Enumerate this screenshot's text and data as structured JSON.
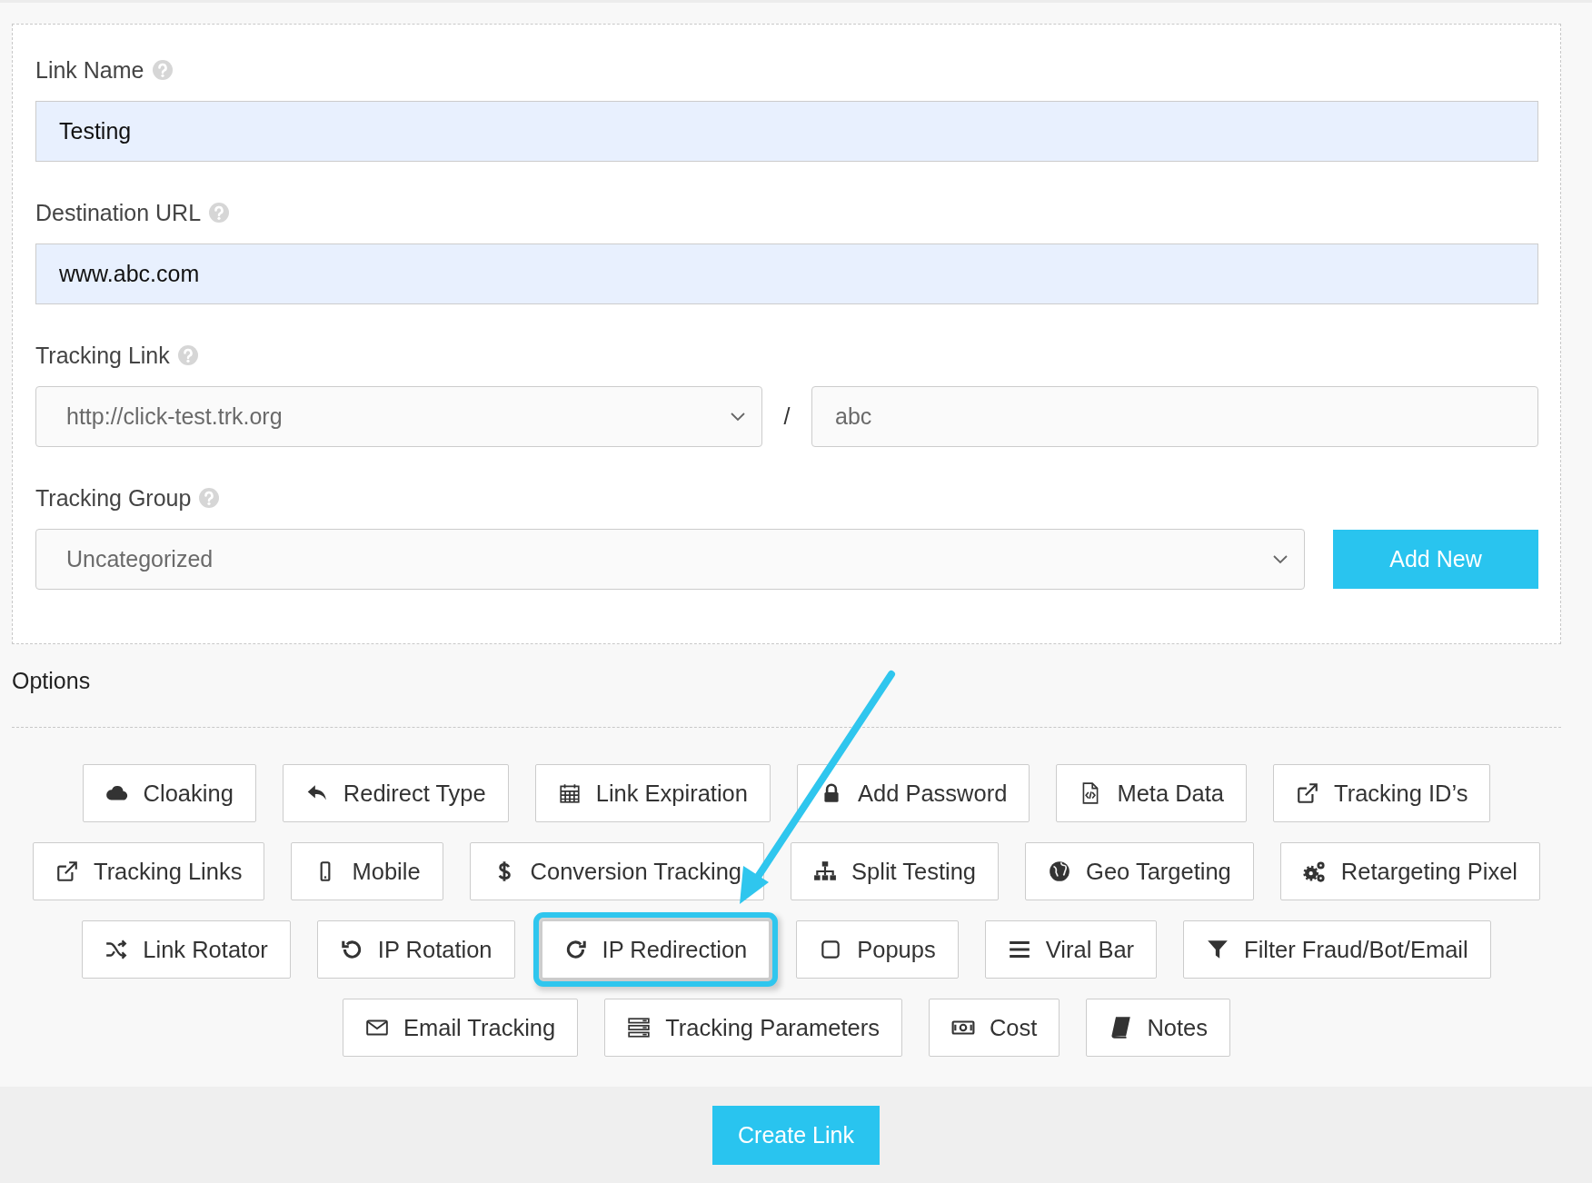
{
  "fields": [
    {
      "label": "Link Name",
      "value": "Testing"
    },
    {
      "label": "Destination URL",
      "value": "www.abc.com"
    }
  ],
  "tracking_link": {
    "label": "Tracking Link",
    "domain": "http://click-test.trk.org",
    "separator": "/",
    "slug": "abc"
  },
  "tracking_group": {
    "label": "Tracking Group",
    "value": "Uncategorized",
    "add_button": "Add New"
  },
  "options": {
    "title": "Options",
    "lines": [
      {
        "buttons": [
          {
            "label": "Cloaking",
            "highlighted": false
          },
          {
            "label": "Redirect Type",
            "highlighted": false
          },
          {
            "label": "Link Expiration",
            "highlighted": false
          },
          {
            "label": "Add Password",
            "highlighted": false
          },
          {
            "label": "Meta Data",
            "highlighted": false
          },
          {
            "label": "Tracking ID’s",
            "highlighted": false
          }
        ]
      },
      {
        "buttons": [
          {
            "label": "Tracking Links",
            "highlighted": false
          },
          {
            "label": "Mobile",
            "highlighted": false
          },
          {
            "label": "Conversion Tracking",
            "highlighted": false
          },
          {
            "label": "Split Testing",
            "highlighted": false
          },
          {
            "label": "Geo Targeting",
            "highlighted": false
          },
          {
            "label": "Retargeting Pixel",
            "highlighted": false
          }
        ]
      },
      {
        "buttons": [
          {
            "label": "Link Rotator",
            "highlighted": false
          },
          {
            "label": "IP Rotation",
            "highlighted": false
          },
          {
            "label": "IP Redirection",
            "highlighted": true
          },
          {
            "label": "Popups",
            "highlighted": false
          },
          {
            "label": "Viral Bar",
            "highlighted": false
          },
          {
            "label": "Filter Fraud/Bot/Email",
            "highlighted": false
          }
        ]
      },
      {
        "buttons": [
          {
            "label": "Email Tracking",
            "highlighted": false
          },
          {
            "label": "Tracking Parameters",
            "highlighted": false
          },
          {
            "label": "Cost",
            "highlighted": false
          },
          {
            "label": "Notes",
            "highlighted": false
          }
        ]
      }
    ]
  },
  "create_button": "Create Link"
}
